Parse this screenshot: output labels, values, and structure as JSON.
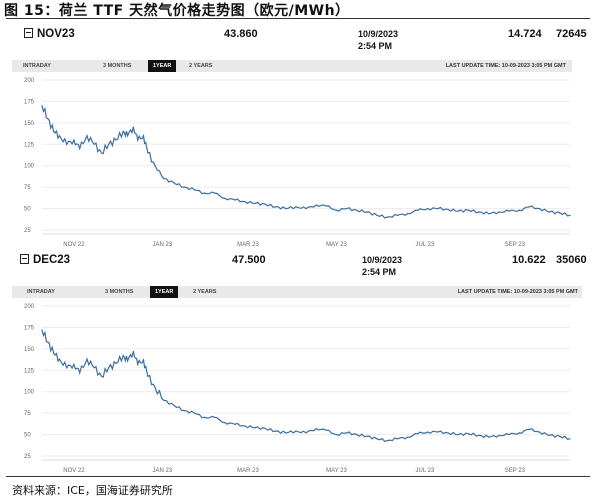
{
  "figure_title": "图 15：荷兰 TTF 天然气价格走势图（欧元/MWh）",
  "source": "资料来源：ICE，国海证券研究所",
  "tabs": [
    "INTRADAY",
    "3 MONTHS",
    "1YEAR",
    "2 YEARS"
  ],
  "active_tab": "1YEAR",
  "panels": [
    {
      "symbol": "NOV23",
      "price": "43.860",
      "date": "10/9/2023",
      "time": "2:54 PM",
      "change": "14.724",
      "volume": "72645",
      "last_update": "LAST UPDATE TIME: 10-09-2023 3:05 PM GMT"
    },
    {
      "symbol": "DEC23",
      "price": "47.500",
      "date": "10/9/2023",
      "time": "2:54 PM",
      "change": "10.622",
      "volume": "35060",
      "last_update": "LAST UPDATE TIME: 10-09-2023 3:05 PM GMT"
    }
  ],
  "chart_data": [
    {
      "type": "line",
      "title": "NOV23",
      "xlabel": "",
      "ylabel": "",
      "ylim": [
        25,
        200
      ],
      "yticks": [
        200,
        175,
        150,
        125,
        100,
        75,
        50,
        25
      ],
      "xticks": [
        "NOV 22",
        "JAN 23",
        "MAR 23",
        "MAY 23",
        "JUL 23",
        "SEP 23"
      ],
      "grid": true,
      "color": "#3c6e9f",
      "x": [
        "2022-10-10",
        "2022-10-14",
        "2022-10-18",
        "2022-10-22",
        "2022-10-27",
        "2022-11-01",
        "2022-11-05",
        "2022-11-10",
        "2022-11-15",
        "2022-11-20",
        "2022-11-25",
        "2022-11-30",
        "2022-12-05",
        "2022-12-08",
        "2022-12-12",
        "2022-12-15",
        "2022-12-19",
        "2022-12-22",
        "2022-12-27",
        "2023-01-02",
        "2023-01-09",
        "2023-01-16",
        "2023-01-23",
        "2023-01-30",
        "2023-02-06",
        "2023-02-13",
        "2023-02-20",
        "2023-02-27",
        "2023-03-06",
        "2023-03-13",
        "2023-03-20",
        "2023-03-27",
        "2023-04-03",
        "2023-04-10",
        "2023-04-17",
        "2023-04-24",
        "2023-05-01",
        "2023-05-08",
        "2023-05-15",
        "2023-05-22",
        "2023-05-29",
        "2023-06-05",
        "2023-06-12",
        "2023-06-19",
        "2023-06-26",
        "2023-07-03",
        "2023-07-10",
        "2023-07-17",
        "2023-07-24",
        "2023-07-31",
        "2023-08-07",
        "2023-08-14",
        "2023-08-21",
        "2023-08-28",
        "2023-09-04",
        "2023-09-11",
        "2023-09-18",
        "2023-09-25",
        "2023-10-02",
        "2023-10-09"
      ],
      "values": [
        170,
        155,
        140,
        135,
        125,
        130,
        120,
        135,
        125,
        115,
        125,
        130,
        140,
        135,
        145,
        130,
        135,
        115,
        100,
        85,
        80,
        75,
        72,
        68,
        68,
        62,
        60,
        58,
        56,
        55,
        52,
        50,
        52,
        50,
        54,
        53,
        48,
        50,
        48,
        46,
        42,
        40,
        42,
        44,
        48,
        50,
        50,
        49,
        47,
        48,
        46,
        44,
        46,
        47,
        48,
        52,
        50,
        46,
        45,
        42
      ]
    },
    {
      "type": "line",
      "title": "DEC23",
      "xlabel": "",
      "ylabel": "",
      "ylim": [
        25,
        200
      ],
      "yticks": [
        200,
        175,
        150,
        125,
        100,
        75,
        50,
        25
      ],
      "xticks": [
        "NOV 22",
        "JAN 23",
        "MAR 23",
        "MAY 23",
        "JUL 23",
        "SEP 23"
      ],
      "grid": true,
      "color": "#3c6e9f",
      "x": [
        "2022-10-10",
        "2022-10-14",
        "2022-10-18",
        "2022-10-22",
        "2022-10-27",
        "2022-11-01",
        "2022-11-05",
        "2022-11-10",
        "2022-11-15",
        "2022-11-20",
        "2022-11-25",
        "2022-11-30",
        "2022-12-05",
        "2022-12-08",
        "2022-12-12",
        "2022-12-15",
        "2022-12-19",
        "2022-12-22",
        "2022-12-27",
        "2023-01-02",
        "2023-01-09",
        "2023-01-16",
        "2023-01-23",
        "2023-01-30",
        "2023-02-06",
        "2023-02-13",
        "2023-02-20",
        "2023-02-27",
        "2023-03-06",
        "2023-03-13",
        "2023-03-20",
        "2023-03-27",
        "2023-04-03",
        "2023-04-10",
        "2023-04-17",
        "2023-04-24",
        "2023-05-01",
        "2023-05-08",
        "2023-05-15",
        "2023-05-22",
        "2023-05-29",
        "2023-06-05",
        "2023-06-12",
        "2023-06-19",
        "2023-06-26",
        "2023-07-03",
        "2023-07-10",
        "2023-07-17",
        "2023-07-24",
        "2023-07-31",
        "2023-08-07",
        "2023-08-14",
        "2023-08-21",
        "2023-08-28",
        "2023-09-04",
        "2023-09-11",
        "2023-09-18",
        "2023-09-25",
        "2023-10-02",
        "2023-10-09"
      ],
      "values": [
        172,
        158,
        145,
        138,
        128,
        132,
        122,
        138,
        128,
        118,
        128,
        133,
        142,
        136,
        147,
        132,
        137,
        118,
        105,
        90,
        84,
        78,
        75,
        70,
        70,
        64,
        62,
        60,
        58,
        57,
        54,
        52,
        54,
        52,
        57,
        55,
        50,
        52,
        50,
        48,
        45,
        43,
        45,
        47,
        51,
        53,
        53,
        52,
        50,
        51,
        49,
        47,
        49,
        50,
        52,
        56,
        53,
        49,
        48,
        45
      ]
    }
  ]
}
